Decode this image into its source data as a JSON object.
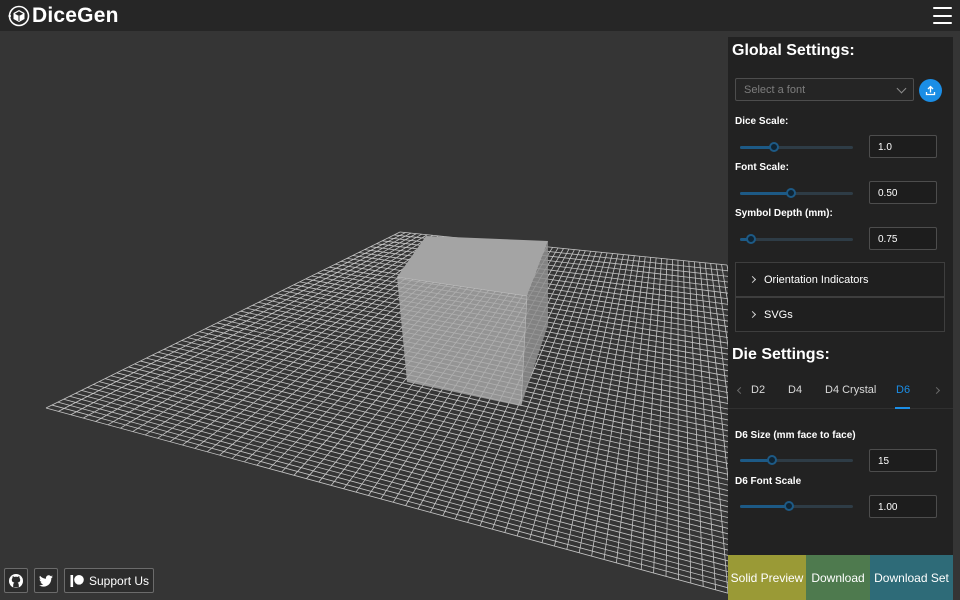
{
  "app": {
    "title": "DiceGen"
  },
  "icons": {
    "logo": "dice-logo-icon",
    "menu": "hamburger-menu-icon",
    "upload": "upload-icon",
    "github": "github-icon",
    "twitter": "twitter-icon",
    "patreon": "patreon-icon"
  },
  "colors": {
    "accent": "#1b8ee6",
    "solid_preview": "#9a9a36",
    "download": "#4e7a4e",
    "download_set": "#2e6b78"
  },
  "global_settings": {
    "title": "Global Settings:",
    "font_select": {
      "placeholder": "Select a font"
    },
    "dice_scale": {
      "label": "Dice Scale:",
      "value": "1.0",
      "level": 0.3
    },
    "font_scale": {
      "label": "Font Scale:",
      "value": "0.50",
      "level": 0.45
    },
    "symbol_depth": {
      "label": "Symbol Depth (mm):",
      "value": "0.75",
      "level": 0.1
    },
    "sections": [
      {
        "label": "Orientation Indicators"
      },
      {
        "label": "SVGs"
      }
    ]
  },
  "die_settings": {
    "title": "Die Settings:",
    "tabs": [
      {
        "label": "D2"
      },
      {
        "label": "D4"
      },
      {
        "label": "D4 Crystal"
      },
      {
        "label": "D6",
        "active": true
      }
    ],
    "d6_size": {
      "label": "D6 Size (mm face to face)",
      "value": "15",
      "level": 0.28
    },
    "d6_font_scale": {
      "label": "D6 Font Scale",
      "value": "1.00",
      "level": 0.43
    }
  },
  "actions": {
    "solid_preview": "Solid Preview",
    "download": "Download",
    "download_set": "Download Set"
  },
  "footer": {
    "support": "Support Us"
  }
}
